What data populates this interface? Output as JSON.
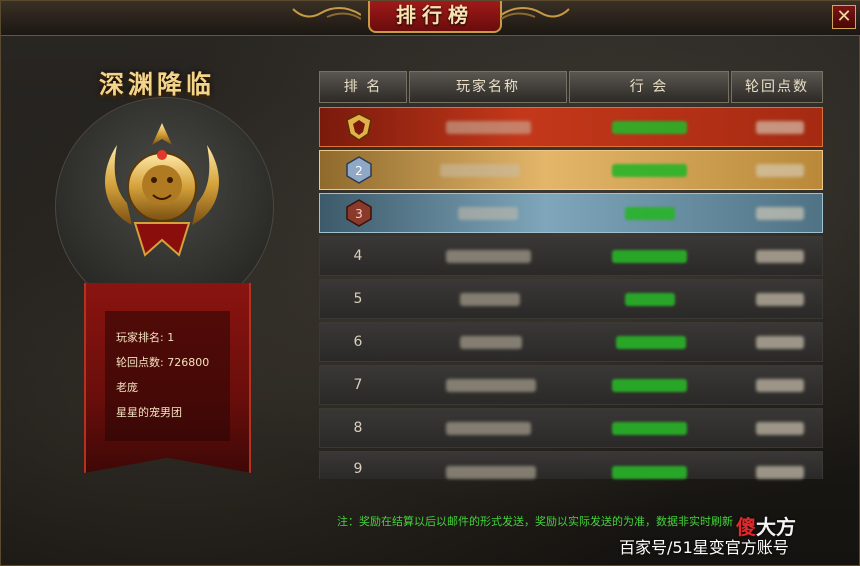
{
  "window": {
    "title": "排行榜",
    "close_glyph": "✕"
  },
  "panel": {
    "title": "深渊降临",
    "emblem_icon": "golden-lion-crest-icon",
    "rank_line": "玩家排名: 1",
    "points_line": "轮回点数: 726800",
    "player_name": "老庞",
    "guild_name": "星星的宠男团"
  },
  "table": {
    "headers": [
      "排 名",
      "玩家名称",
      "行 会",
      "轮回点数"
    ],
    "rows": [
      {
        "rank": "1",
        "medal": "gold-medal-icon"
      },
      {
        "rank": "2",
        "medal": "silver-medal-icon"
      },
      {
        "rank": "3",
        "medal": "bronze-medal-icon"
      },
      {
        "rank": "4"
      },
      {
        "rank": "5"
      },
      {
        "rank": "6"
      },
      {
        "rank": "7"
      },
      {
        "rank": "8"
      },
      {
        "rank": "9"
      }
    ]
  },
  "note": "注：奖励在结算以后以邮件的形式发送，奖励以实际发送的为准，数据非实时刷新",
  "watermark": {
    "caption": "百家号/51星变官方账号",
    "logo_red": "傻",
    "logo_white": "大方"
  },
  "colors": {
    "accent_gold": "#c79a45",
    "title_red": "#a01a1a",
    "guild_green": "#28b428",
    "note_green": "#43d43a"
  }
}
